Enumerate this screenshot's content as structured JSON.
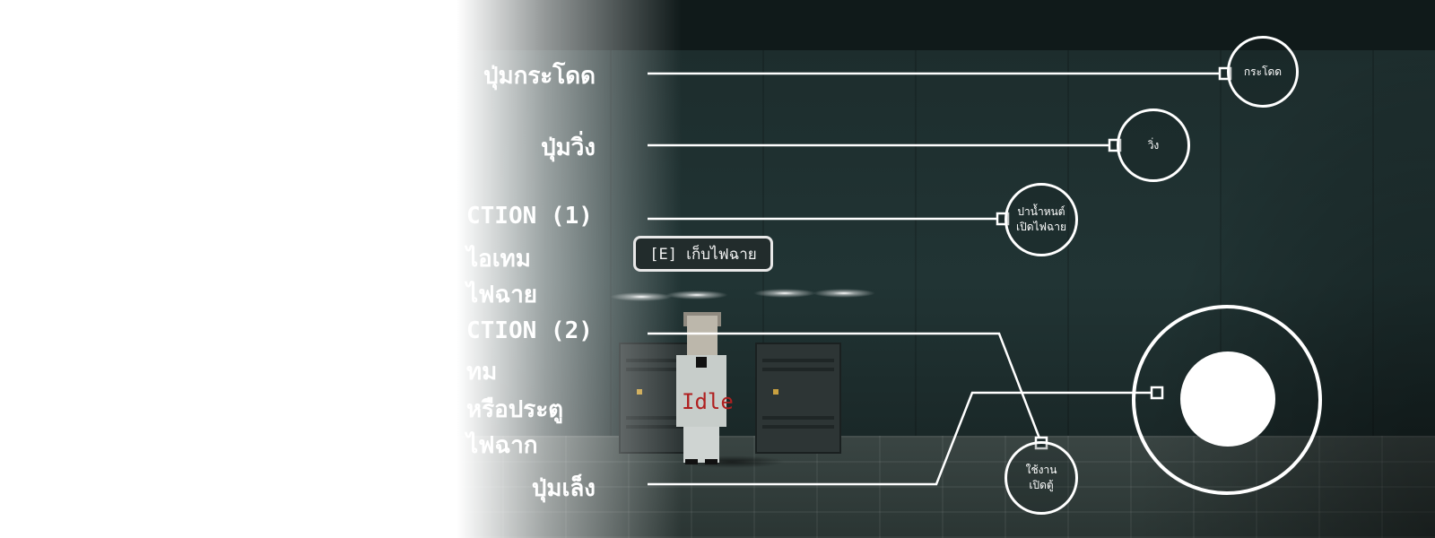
{
  "labels": {
    "jump": "ปุ่มกระโดด",
    "run": "ปุ่มวิ่ง",
    "action1_title": "CTION (1)",
    "action1_line1": "ไอเทม",
    "action1_line2": "ไฟฉาย",
    "action2_title": "CTION (2)",
    "action2_line1": "ทม",
    "action2_line2": "หรือประตู",
    "action2_line3": "ไฟฉาก",
    "aim": "ปุ่มเล็ง"
  },
  "buttons": {
    "jump": "กระโดด",
    "run": "วิ่ง",
    "action1_line1": "ปาน้ำหนต์",
    "action1_line2": "เปิดไฟฉาย",
    "action2_line1": "ใช้งาน",
    "action2_line2": "เปิดตู้"
  },
  "game": {
    "pickup_prompt": "[E] เก็บไฟฉาย",
    "character_state": "Idle"
  },
  "colors": {
    "ui_line": "#ffffff",
    "state_text": "#b02020",
    "background": "#1c2b2b"
  }
}
